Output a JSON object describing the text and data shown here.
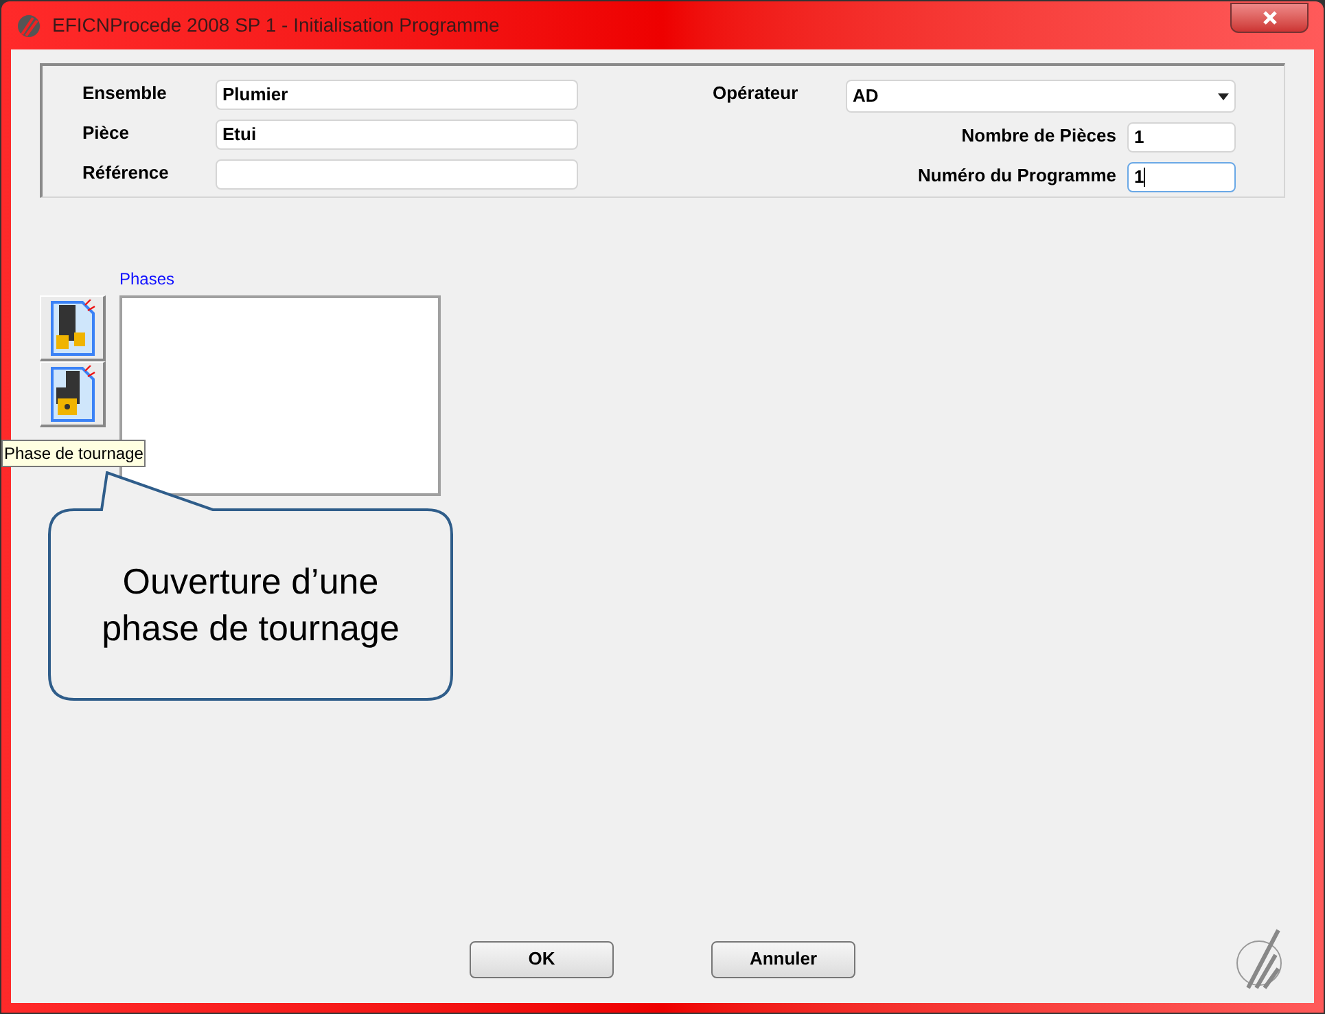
{
  "window": {
    "title": "EFICNProcede 2008 SP 1 - Initialisation Programme"
  },
  "left_fields": [
    {
      "label": "Ensemble",
      "value": "Plumier"
    },
    {
      "label": "Pièce",
      "value": "Etui"
    },
    {
      "label": "Référence"
    }
  ],
  "operator": {
    "label": "Opérateur",
    "value": "AD"
  },
  "right_fields": [
    {
      "label": "Nombre de Pièces",
      "value": "1",
      "focused": false
    },
    {
      "label": "Numéro du Programme",
      "value": "1",
      "focused": true
    }
  ],
  "phases": {
    "label": "Phases"
  },
  "tooltip": "Phase de tournage",
  "callout": "Ouverture d’une phase de tournage",
  "buttons": [
    "OK",
    "Annuler"
  ]
}
